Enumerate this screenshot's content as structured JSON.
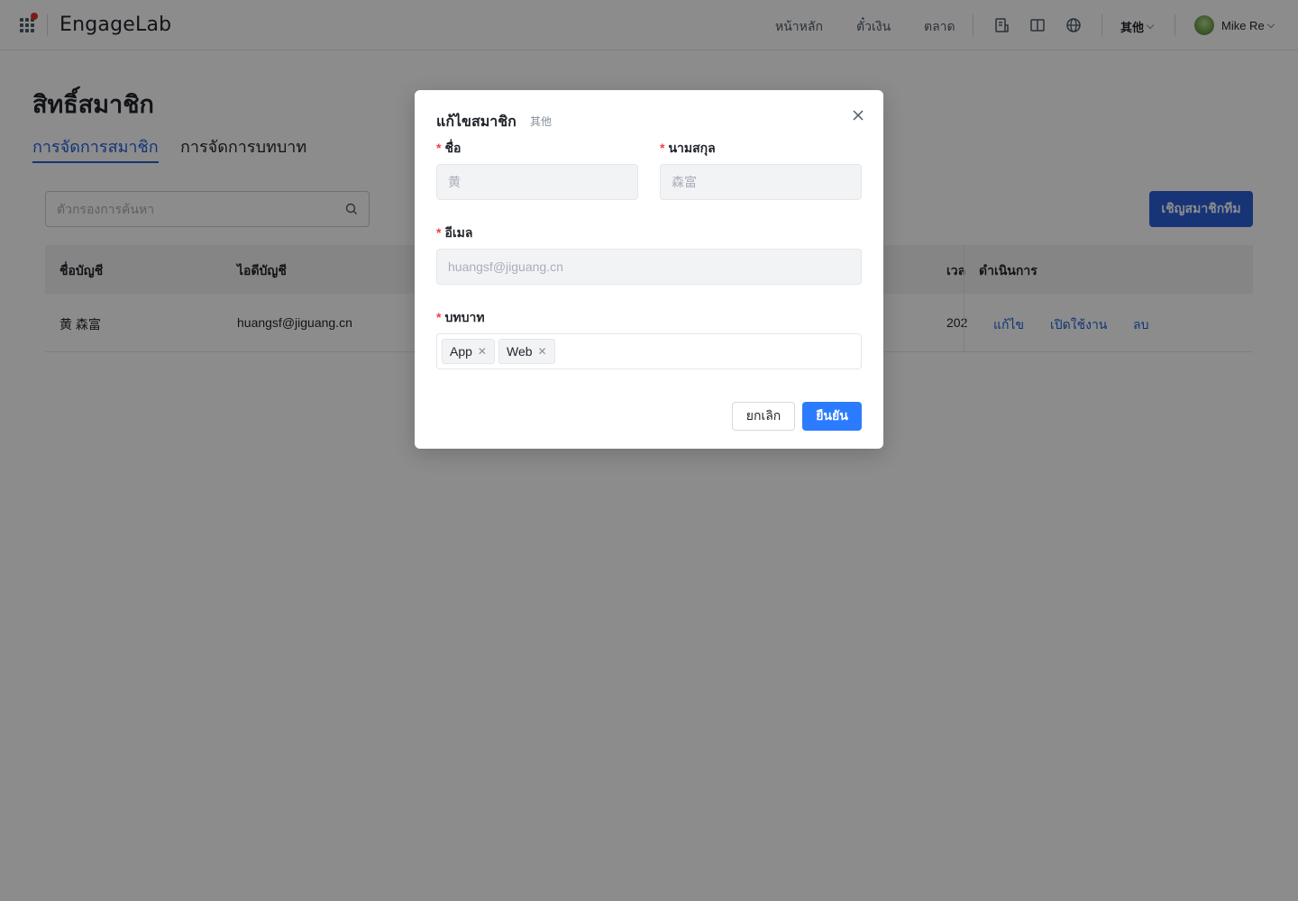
{
  "header": {
    "logo": "EngageLab",
    "nav": [
      "หน้าหลัก",
      "ตั๋วเงิน",
      "ตลาด"
    ],
    "other_label": "其他",
    "user_name": "Mike Re"
  },
  "page": {
    "title": "สิทธิ์สมาชิก",
    "tabs": [
      "การจัดการสมาชิก",
      "การจัดการบทบาท"
    ],
    "search_placeholder": "ตัวกรองการค้นหา",
    "invite_button": "เชิญสมาชิกทีม",
    "table": {
      "headers": [
        "ชื่อบัญชี",
        "ไอดีบัญชี",
        "เวล",
        "ดำเนินการ"
      ],
      "rows": [
        {
          "name": "黄 森富",
          "account_id": "huangsf@jiguang.cn",
          "time": "202",
          "ops": [
            "แก้ไข",
            "เปิดใช้งาน",
            "ลบ"
          ]
        }
      ]
    }
  },
  "modal": {
    "title": "แก้ไขสมาชิก",
    "subtitle": "其他",
    "first_name_label": "ชื่อ",
    "first_name_value": "黄",
    "last_name_label": "นามสกุล",
    "last_name_value": "森富",
    "email_label": "อีเมล",
    "email_value": "huangsf@jiguang.cn",
    "role_label": "บทบาท",
    "roles": [
      "App",
      "Web"
    ],
    "cancel": "ยกเลิก",
    "confirm": "ยืนยัน"
  },
  "colors": {
    "primary": "#2b7bff",
    "link": "#1f5fd6",
    "required": "#f53f3f",
    "overlay": "rgba(0,0,0,0.45)"
  }
}
